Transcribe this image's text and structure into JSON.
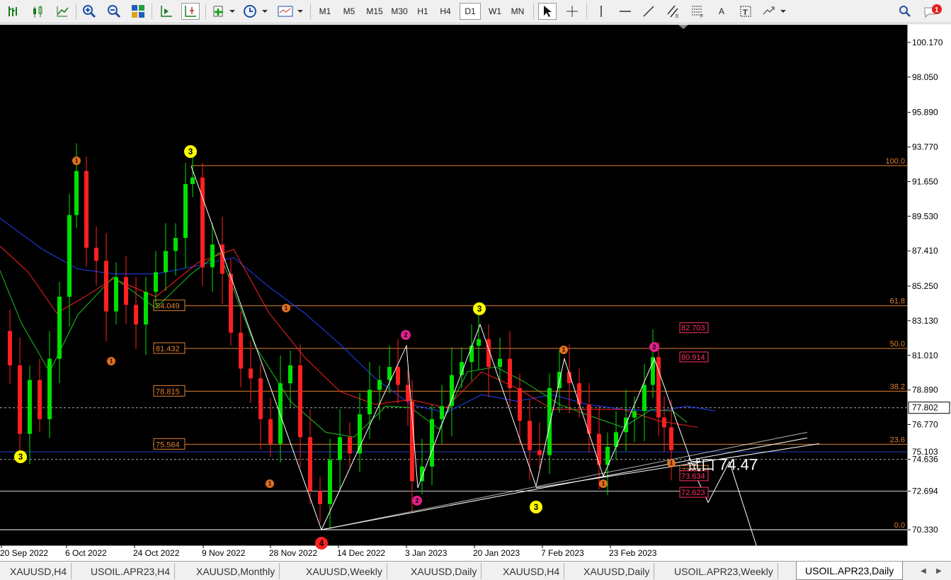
{
  "toolbar": {
    "icons": [
      "bar-chart-icon",
      "candle-chart-icon",
      "line-chart-icon",
      "zoom-in-icon",
      "zoom-out-icon",
      "tile-windows-icon",
      "autoscroll-icon",
      "chart-shift-icon",
      "new-indicator-icon",
      "clock-icon",
      "templates-icon"
    ],
    "timeframes": [
      "M1",
      "M5",
      "M15",
      "M30",
      "H1",
      "H4",
      "D1",
      "W1",
      "MN"
    ],
    "active_timeframe": "D1",
    "text_tool": "A",
    "notification_count": "1"
  },
  "chart": {
    "price_labels": [
      "100.170",
      "98.050",
      "95.890",
      "93.770",
      "91.650",
      "89.530",
      "87.410",
      "85.250",
      "83.130",
      "81.010",
      "78.890",
      "76.770",
      "74.636",
      "72.694",
      "70.330"
    ],
    "current_price_label": "77.802",
    "level_label_75103": "75.103",
    "date_labels": [
      "20 Sep 2022",
      "6 Oct 2022",
      "24 Oct 2022",
      "9 Nov 2022",
      "28 Nov 2022",
      "14 Dec 2022",
      "3 Jan 2023",
      "20 Jan 2023",
      "7 Feb 2023",
      "23 Feb 2023"
    ],
    "fib_levels": [
      {
        "pct": "100.0",
        "price": null
      },
      {
        "pct": "61.8",
        "price": "84.049"
      },
      {
        "pct": "50.0",
        "price": "81.432"
      },
      {
        "pct": "38.2",
        "price": "78.815"
      },
      {
        "pct": "23.6",
        "price": "75.564"
      },
      {
        "pct": "0.0",
        "price": null
      }
    ],
    "right_boxes": [
      "82.703",
      "80.914",
      "73.962",
      "73.634",
      "72.623"
    ],
    "annotation": "74.47",
    "annotation_prefix": "试口",
    "wave_labels": {
      "yellow": "3",
      "orange": "1",
      "magenta": "2",
      "red": "4"
    },
    "colors": {
      "background": "#000000",
      "bull_candle": "#00e000",
      "bear_candle": "#ff2020",
      "fib_line": "#e08030",
      "ma_blue": "#2040ff",
      "ma_red": "#ff2020",
      "ma_green": "#20c020",
      "trend_line": "#ffffff"
    }
  },
  "tabs": [
    "XAUUSD,H4",
    "USOIL.APR23,H4",
    "XAUUSD,Monthly",
    "XAUUSD,Weekly",
    "XAUUSD,Daily",
    "XAUUSD,H4",
    "XAUUSD,Daily",
    "USOIL.APR23,Weekly",
    "USOIL.APR23,Daily"
  ],
  "active_tab": "USOIL.APR23,Daily"
}
